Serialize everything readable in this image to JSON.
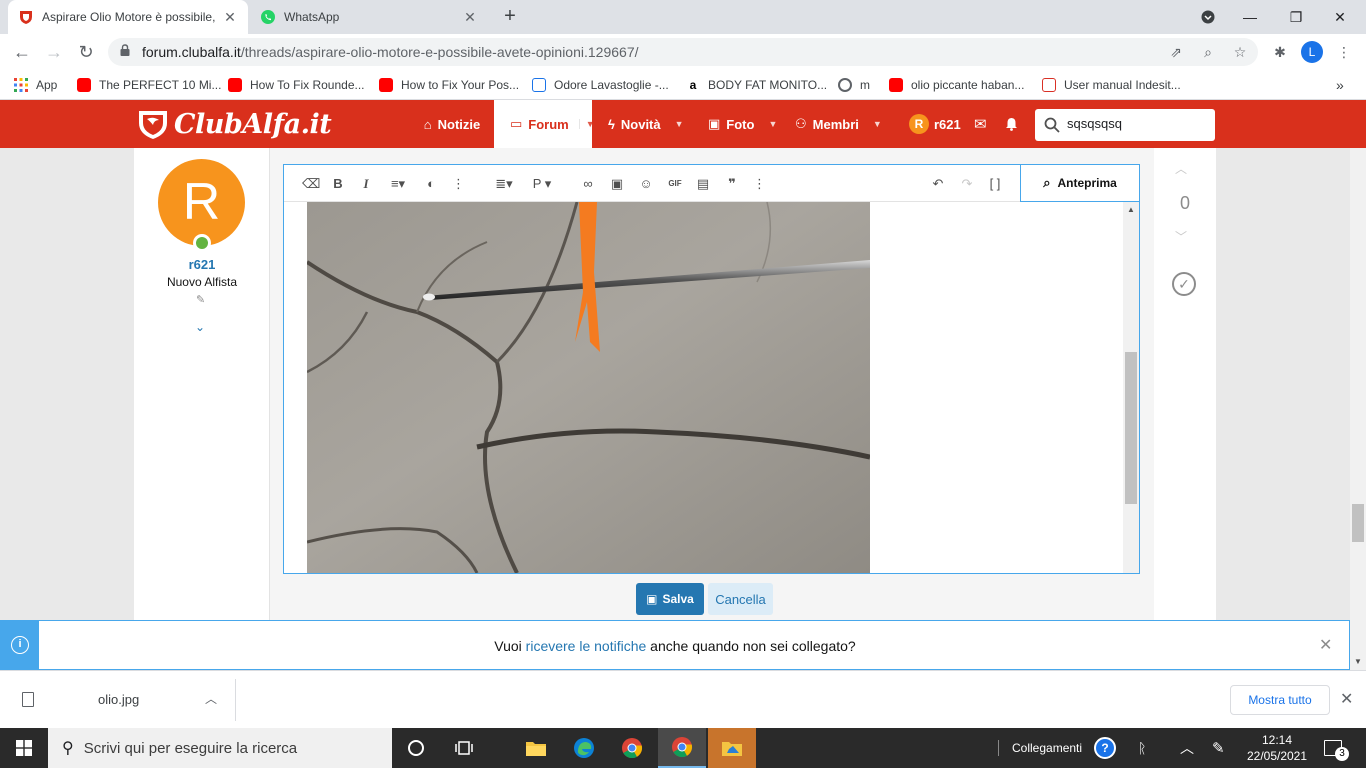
{
  "browser": {
    "tabs": [
      {
        "title": "Aspirare Olio Motore è possibile,",
        "active": true
      },
      {
        "title": "WhatsApp",
        "active": false
      }
    ],
    "url_host": "forum.clubalfa.it",
    "url_path": "/threads/aspirare-olio-motore-e-possibile-avete-opinioni.129667/",
    "profile_initial": "L"
  },
  "bookmarks": [
    {
      "label": "App",
      "icon": "apps-grid-icon"
    },
    {
      "label": "The PERFECT 10 Mi...",
      "icon": "youtube-icon"
    },
    {
      "label": "How To Fix Rounde...",
      "icon": "youtube-icon"
    },
    {
      "label": "How to Fix Your Pos...",
      "icon": "youtube-icon"
    },
    {
      "label": "Odore Lavastoglie -...",
      "icon": "page-icon"
    },
    {
      "label": "BODY FAT MONITO...",
      "icon": "amazon-icon"
    },
    {
      "label": "m",
      "icon": "globe-icon"
    },
    {
      "label": "olio piccante haban...",
      "icon": "youtube-icon"
    },
    {
      "label": "User manual Indesit...",
      "icon": "pdf-icon"
    }
  ],
  "site": {
    "logo": "ClubAlfa.it",
    "nav": {
      "news": "Notizie",
      "forum": "Forum",
      "whats_new": "Novità",
      "photos": "Foto",
      "members": "Membri",
      "user": "r621",
      "user_initial": "R"
    },
    "search_value": "sqsqsqsq",
    "brand_color": "#d9301c"
  },
  "post": {
    "author": {
      "initial": "R",
      "name": "r621",
      "title": "Nuovo Alfista"
    },
    "vote_count": "0",
    "editor": {
      "preview_label": "Anteprima",
      "gif_label": "GIF",
      "paragraph_label": "P"
    },
    "save_label": "Salva",
    "cancel_label": "Cancella"
  },
  "notice": {
    "prefix": "Vuoi ",
    "link": "ricevere le notifiche",
    "suffix": " anche quando non sei collegato?"
  },
  "downloads": {
    "filename": "olio.jpg",
    "show_all": "Mostra tutto"
  },
  "taskbar": {
    "search_placeholder": "Scrivi qui per eseguire la ricerca",
    "connections": "Collegamenti",
    "time": "12:14",
    "date": "22/05/2021",
    "notification_count": "3"
  }
}
